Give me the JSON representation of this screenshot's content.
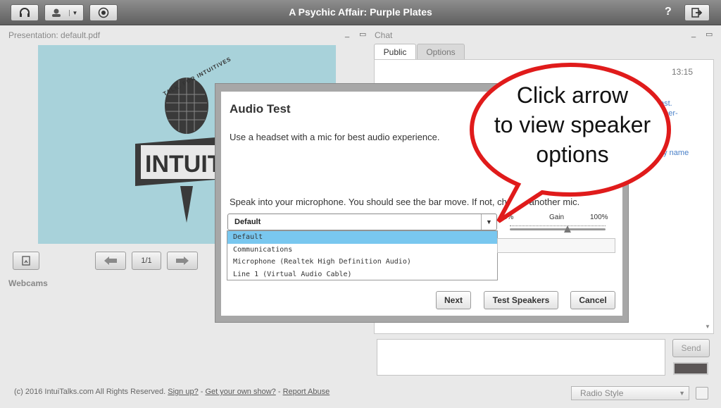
{
  "app": {
    "title": "A Psychic Affair: Purple Plates",
    "help_label": "?"
  },
  "presentation": {
    "header": "Presentation: default.pdf",
    "page_indicator": "1/1",
    "logo_text_top": "TALK. FOR INTUITIVES",
    "logo_text_main": "INTUITALKS"
  },
  "webcams": {
    "header": "Webcams"
  },
  "chat": {
    "header": "Chat",
    "tabs": [
      {
        "label": "Public"
      },
      {
        "label": "Options"
      }
    ],
    "timestamp": "13:15",
    "snippets": [
      "ost.",
      "pper-",
      "by name"
    ],
    "send_label": "Send"
  },
  "modal": {
    "title": "Audio Test",
    "headset_note": "Use a headset with a mic for best audio experience.",
    "instruction": "Speak into your microphone. You should see the bar move. If not, choose another mic.",
    "selected_device": "Default",
    "device_options": [
      "Default",
      "Communications",
      "Microphone (Realtek High Definition Audio)",
      "Line 1 (Virtual Audio Cable)"
    ],
    "gain": {
      "min_label": "0%",
      "label": "Gain",
      "max_label": "100%",
      "level": 0.6
    },
    "buttons": {
      "next": "Next",
      "test_speakers": "Test Speakers",
      "cancel": "Cancel"
    }
  },
  "callout": {
    "line1": "Click arrow",
    "line2": "to view speaker",
    "line3": "options"
  },
  "footer": {
    "copyright": "(c) 2016 IntuiTalks.com All Rights Reserved.",
    "sign_up": "Sign up?",
    "get_show": "Get your own show?",
    "report": "Report Abuse",
    "separator": "-",
    "layout_select": "Radio Style"
  },
  "colors": {
    "topbar": "#6f6f6f",
    "slide_background": "#a8d2da",
    "selected_option": "#79c7ef",
    "callout_fill": "#ffffff",
    "callout_stroke": "#e01b1b"
  }
}
